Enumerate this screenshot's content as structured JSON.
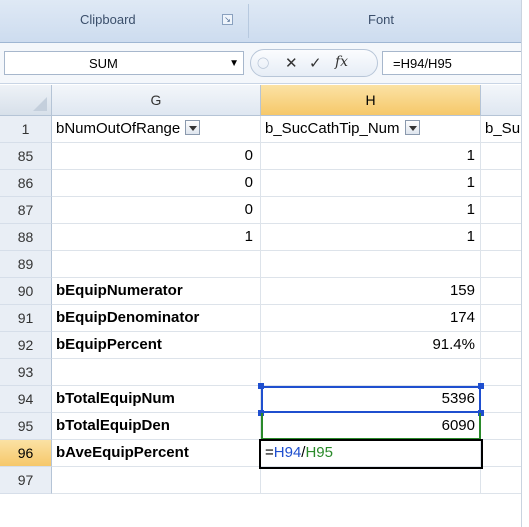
{
  "ribbon": {
    "groups": [
      "Clipboard",
      "Font"
    ]
  },
  "formula_bar": {
    "name_box": "SUM",
    "icons": [
      "cancel-icon",
      "enter-icon",
      "insert-function-icon"
    ],
    "formula": "=H94/H95"
  },
  "columns": [
    "G",
    "H"
  ],
  "header_row": {
    "row_num": "1",
    "G": "bNumOutOfRange",
    "H": "b_SucCathTip_Num",
    "I": "b_Su"
  },
  "rows": [
    {
      "n": "85",
      "G": "0",
      "H": "1"
    },
    {
      "n": "86",
      "G": "0",
      "H": "1"
    },
    {
      "n": "87",
      "G": "0",
      "H": "1"
    },
    {
      "n": "88",
      "G": "1",
      "H": "1"
    },
    {
      "n": "89",
      "G": "",
      "H": ""
    },
    {
      "n": "90",
      "G": "bEquipNumerator",
      "H": "159"
    },
    {
      "n": "91",
      "G": "bEquipDenominator",
      "H": "174"
    },
    {
      "n": "92",
      "G": "bEquipPercent",
      "H": "91.4%"
    },
    {
      "n": "93",
      "G": "",
      "H": ""
    },
    {
      "n": "94",
      "G": "bTotalEquipNum",
      "H": "5396"
    },
    {
      "n": "95",
      "G": "bTotalEquipDen",
      "H": "6090"
    },
    {
      "n": "96",
      "G": "bAveEquipPercent",
      "H_prefix": "=",
      "H_ref1": "H94",
      "H_sep": "/",
      "H_ref2": "H95"
    },
    {
      "n": "97",
      "G": "",
      "H": ""
    }
  ],
  "colors": {
    "ref1": "#1f4fcf",
    "ref2": "#2a8a2a",
    "selected_header": "#f6c86a"
  }
}
